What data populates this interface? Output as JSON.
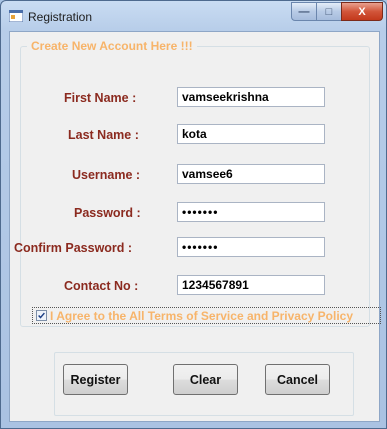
{
  "window": {
    "title": "Registration",
    "min_glyph": "—",
    "max_glyph": "□",
    "close_glyph": "X"
  },
  "group": {
    "legend": "Create New Account Here !!!"
  },
  "form": {
    "fields": [
      {
        "label": "First Name :",
        "value": "vamseekrishna"
      },
      {
        "label": "Last Name :",
        "value": "kota"
      },
      {
        "label": "Username :",
        "value": "vamsee6"
      },
      {
        "label": "Password :",
        "value": "•••••••"
      },
      {
        "label": "Confirm Password :",
        "value": "•••••••"
      },
      {
        "label": "Contact No :",
        "value": "1234567891"
      }
    ]
  },
  "agreement": {
    "checked": true,
    "label": "I Agree to the All Terms of Service and Privacy Policy"
  },
  "buttons": {
    "register": "Register",
    "clear": "Clear",
    "cancel": "Cancel"
  },
  "colors": {
    "legend": "#f7b46a",
    "label": "#8b2a1f",
    "close": "#c3391c"
  },
  "icons": [
    "app-icon",
    "minimize-icon",
    "maximize-icon",
    "close-icon",
    "checkmark-icon"
  ]
}
